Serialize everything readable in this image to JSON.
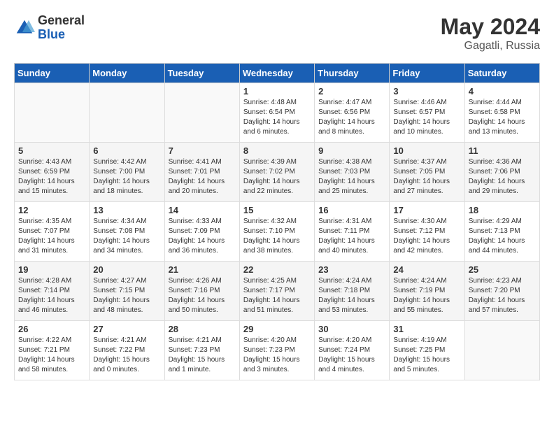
{
  "header": {
    "logo_general": "General",
    "logo_blue": "Blue",
    "month_year": "May 2024",
    "location": "Gagatli, Russia"
  },
  "days_of_week": [
    "Sunday",
    "Monday",
    "Tuesday",
    "Wednesday",
    "Thursday",
    "Friday",
    "Saturday"
  ],
  "weeks": [
    [
      {
        "day": "",
        "info": ""
      },
      {
        "day": "",
        "info": ""
      },
      {
        "day": "",
        "info": ""
      },
      {
        "day": "1",
        "info": "Sunrise: 4:48 AM\nSunset: 6:54 PM\nDaylight: 14 hours\nand 6 minutes."
      },
      {
        "day": "2",
        "info": "Sunrise: 4:47 AM\nSunset: 6:56 PM\nDaylight: 14 hours\nand 8 minutes."
      },
      {
        "day": "3",
        "info": "Sunrise: 4:46 AM\nSunset: 6:57 PM\nDaylight: 14 hours\nand 10 minutes."
      },
      {
        "day": "4",
        "info": "Sunrise: 4:44 AM\nSunset: 6:58 PM\nDaylight: 14 hours\nand 13 minutes."
      }
    ],
    [
      {
        "day": "5",
        "info": "Sunrise: 4:43 AM\nSunset: 6:59 PM\nDaylight: 14 hours\nand 15 minutes."
      },
      {
        "day": "6",
        "info": "Sunrise: 4:42 AM\nSunset: 7:00 PM\nDaylight: 14 hours\nand 18 minutes."
      },
      {
        "day": "7",
        "info": "Sunrise: 4:41 AM\nSunset: 7:01 PM\nDaylight: 14 hours\nand 20 minutes."
      },
      {
        "day": "8",
        "info": "Sunrise: 4:39 AM\nSunset: 7:02 PM\nDaylight: 14 hours\nand 22 minutes."
      },
      {
        "day": "9",
        "info": "Sunrise: 4:38 AM\nSunset: 7:03 PM\nDaylight: 14 hours\nand 25 minutes."
      },
      {
        "day": "10",
        "info": "Sunrise: 4:37 AM\nSunset: 7:05 PM\nDaylight: 14 hours\nand 27 minutes."
      },
      {
        "day": "11",
        "info": "Sunrise: 4:36 AM\nSunset: 7:06 PM\nDaylight: 14 hours\nand 29 minutes."
      }
    ],
    [
      {
        "day": "12",
        "info": "Sunrise: 4:35 AM\nSunset: 7:07 PM\nDaylight: 14 hours\nand 31 minutes."
      },
      {
        "day": "13",
        "info": "Sunrise: 4:34 AM\nSunset: 7:08 PM\nDaylight: 14 hours\nand 34 minutes."
      },
      {
        "day": "14",
        "info": "Sunrise: 4:33 AM\nSunset: 7:09 PM\nDaylight: 14 hours\nand 36 minutes."
      },
      {
        "day": "15",
        "info": "Sunrise: 4:32 AM\nSunset: 7:10 PM\nDaylight: 14 hours\nand 38 minutes."
      },
      {
        "day": "16",
        "info": "Sunrise: 4:31 AM\nSunset: 7:11 PM\nDaylight: 14 hours\nand 40 minutes."
      },
      {
        "day": "17",
        "info": "Sunrise: 4:30 AM\nSunset: 7:12 PM\nDaylight: 14 hours\nand 42 minutes."
      },
      {
        "day": "18",
        "info": "Sunrise: 4:29 AM\nSunset: 7:13 PM\nDaylight: 14 hours\nand 44 minutes."
      }
    ],
    [
      {
        "day": "19",
        "info": "Sunrise: 4:28 AM\nSunset: 7:14 PM\nDaylight: 14 hours\nand 46 minutes."
      },
      {
        "day": "20",
        "info": "Sunrise: 4:27 AM\nSunset: 7:15 PM\nDaylight: 14 hours\nand 48 minutes."
      },
      {
        "day": "21",
        "info": "Sunrise: 4:26 AM\nSunset: 7:16 PM\nDaylight: 14 hours\nand 50 minutes."
      },
      {
        "day": "22",
        "info": "Sunrise: 4:25 AM\nSunset: 7:17 PM\nDaylight: 14 hours\nand 51 minutes."
      },
      {
        "day": "23",
        "info": "Sunrise: 4:24 AM\nSunset: 7:18 PM\nDaylight: 14 hours\nand 53 minutes."
      },
      {
        "day": "24",
        "info": "Sunrise: 4:24 AM\nSunset: 7:19 PM\nDaylight: 14 hours\nand 55 minutes."
      },
      {
        "day": "25",
        "info": "Sunrise: 4:23 AM\nSunset: 7:20 PM\nDaylight: 14 hours\nand 57 minutes."
      }
    ],
    [
      {
        "day": "26",
        "info": "Sunrise: 4:22 AM\nSunset: 7:21 PM\nDaylight: 14 hours\nand 58 minutes."
      },
      {
        "day": "27",
        "info": "Sunrise: 4:21 AM\nSunset: 7:22 PM\nDaylight: 15 hours\nand 0 minutes."
      },
      {
        "day": "28",
        "info": "Sunrise: 4:21 AM\nSunset: 7:23 PM\nDaylight: 15 hours\nand 1 minute."
      },
      {
        "day": "29",
        "info": "Sunrise: 4:20 AM\nSunset: 7:23 PM\nDaylight: 15 hours\nand 3 minutes."
      },
      {
        "day": "30",
        "info": "Sunrise: 4:20 AM\nSunset: 7:24 PM\nDaylight: 15 hours\nand 4 minutes."
      },
      {
        "day": "31",
        "info": "Sunrise: 4:19 AM\nSunset: 7:25 PM\nDaylight: 15 hours\nand 5 minutes."
      },
      {
        "day": "",
        "info": ""
      }
    ]
  ]
}
